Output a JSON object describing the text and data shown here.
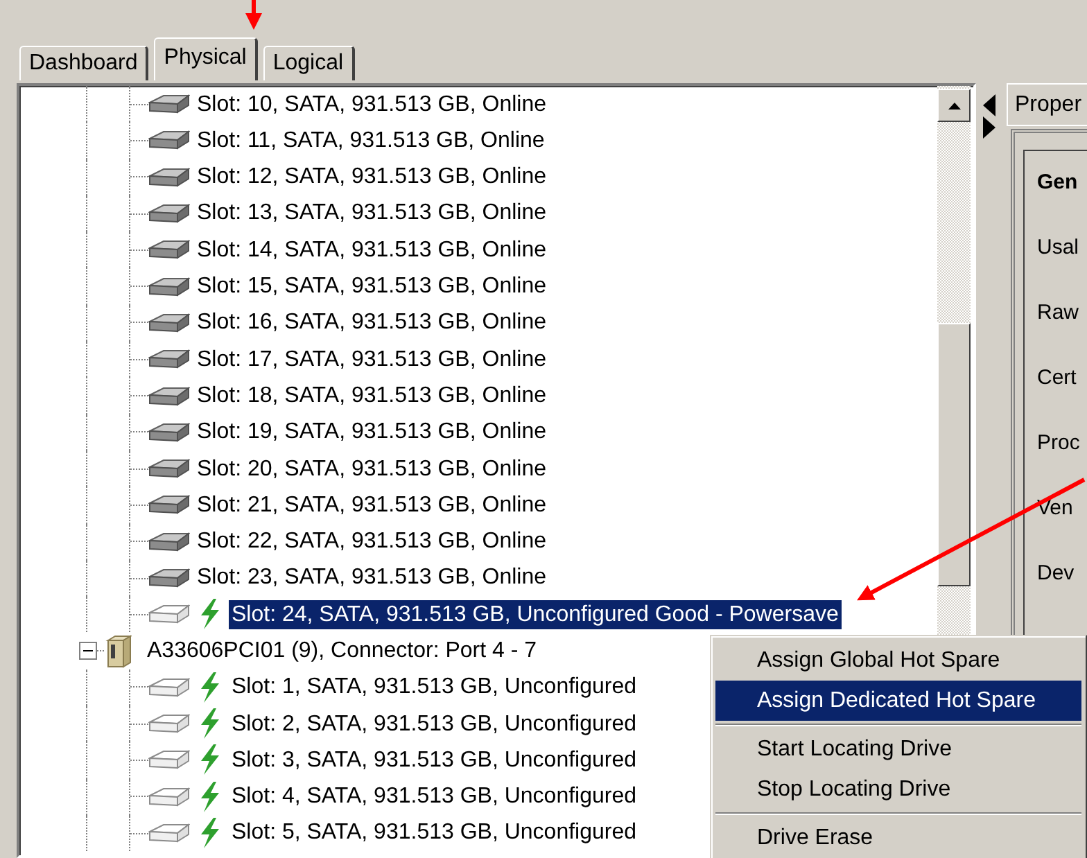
{
  "tabs": [
    {
      "label": "Dashboard",
      "selected": false
    },
    {
      "label": "Physical",
      "selected": true
    },
    {
      "label": "Logical",
      "selected": false
    }
  ],
  "tree": {
    "items": [
      {
        "kind": "continued",
        "children": [
          {
            "label": "Slot: 10, SATA, 931.513 GB, Online",
            "kind": "online",
            "powersave": false,
            "selected": false
          },
          {
            "label": "Slot: 11, SATA, 931.513 GB, Online",
            "kind": "online",
            "powersave": false,
            "selected": false
          },
          {
            "label": "Slot: 12, SATA, 931.513 GB, Online",
            "kind": "online",
            "powersave": false,
            "selected": false
          },
          {
            "label": "Slot: 13, SATA, 931.513 GB, Online",
            "kind": "online",
            "powersave": false,
            "selected": false
          },
          {
            "label": "Slot: 14, SATA, 931.513 GB, Online",
            "kind": "online",
            "powersave": false,
            "selected": false
          },
          {
            "label": "Slot: 15, SATA, 931.513 GB, Online",
            "kind": "online",
            "powersave": false,
            "selected": false
          },
          {
            "label": "Slot: 16, SATA, 931.513 GB, Online",
            "kind": "online",
            "powersave": false,
            "selected": false
          },
          {
            "label": "Slot: 17, SATA, 931.513 GB, Online",
            "kind": "online",
            "powersave": false,
            "selected": false
          },
          {
            "label": "Slot: 18, SATA, 931.513 GB, Online",
            "kind": "online",
            "powersave": false,
            "selected": false
          },
          {
            "label": "Slot: 19, SATA, 931.513 GB, Online",
            "kind": "online",
            "powersave": false,
            "selected": false
          },
          {
            "label": "Slot: 20, SATA, 931.513 GB, Online",
            "kind": "online",
            "powersave": false,
            "selected": false
          },
          {
            "label": "Slot: 21, SATA, 931.513 GB, Online",
            "kind": "online",
            "powersave": false,
            "selected": false
          },
          {
            "label": "Slot: 22, SATA, 931.513 GB, Online",
            "kind": "online",
            "powersave": false,
            "selected": false
          },
          {
            "label": "Slot: 23, SATA, 931.513 GB, Online",
            "kind": "online",
            "powersave": false,
            "selected": false
          },
          {
            "label": "Slot: 24, SATA, 931.513 GB, Unconfigured Good - Powersave",
            "kind": "unconfigured",
            "powersave": true,
            "selected": true
          }
        ]
      },
      {
        "kind": "controller",
        "label": "A33606PCI01 (9), Connector: Port 4 - 7",
        "expanded": true,
        "children": [
          {
            "label": "Slot: 1, SATA, 931.513 GB, Unconfigured",
            "kind": "unconfigured",
            "powersave": true,
            "selected": false
          },
          {
            "label": "Slot: 2, SATA, 931.513 GB, Unconfigured",
            "kind": "unconfigured",
            "powersave": true,
            "selected": false
          },
          {
            "label": "Slot: 3, SATA, 931.513 GB, Unconfigured",
            "kind": "unconfigured",
            "powersave": true,
            "selected": false
          },
          {
            "label": "Slot: 4, SATA, 931.513 GB, Unconfigured",
            "kind": "unconfigured",
            "powersave": true,
            "selected": false
          },
          {
            "label": "Slot: 5, SATA, 931.513 GB, Unconfigured",
            "kind": "unconfigured",
            "powersave": true,
            "selected": false
          }
        ]
      }
    ]
  },
  "properties": {
    "tab": "Proper",
    "heading": "Gen",
    "labels": [
      "Usal",
      "Raw",
      "Cert",
      "Proc",
      "Ven",
      "Dev"
    ]
  },
  "context_menu": {
    "sections": [
      {
        "items": [
          {
            "label": "Assign Global Hot Spare",
            "selected": false
          },
          {
            "label": "Assign Dedicated Hot Spare",
            "selected": true
          }
        ]
      },
      {
        "items": [
          {
            "label": "Start Locating Drive",
            "selected": false
          },
          {
            "label": "Stop Locating Drive",
            "selected": false
          }
        ]
      },
      {
        "items": [
          {
            "label": "Drive Erase",
            "selected": false
          }
        ]
      }
    ]
  }
}
